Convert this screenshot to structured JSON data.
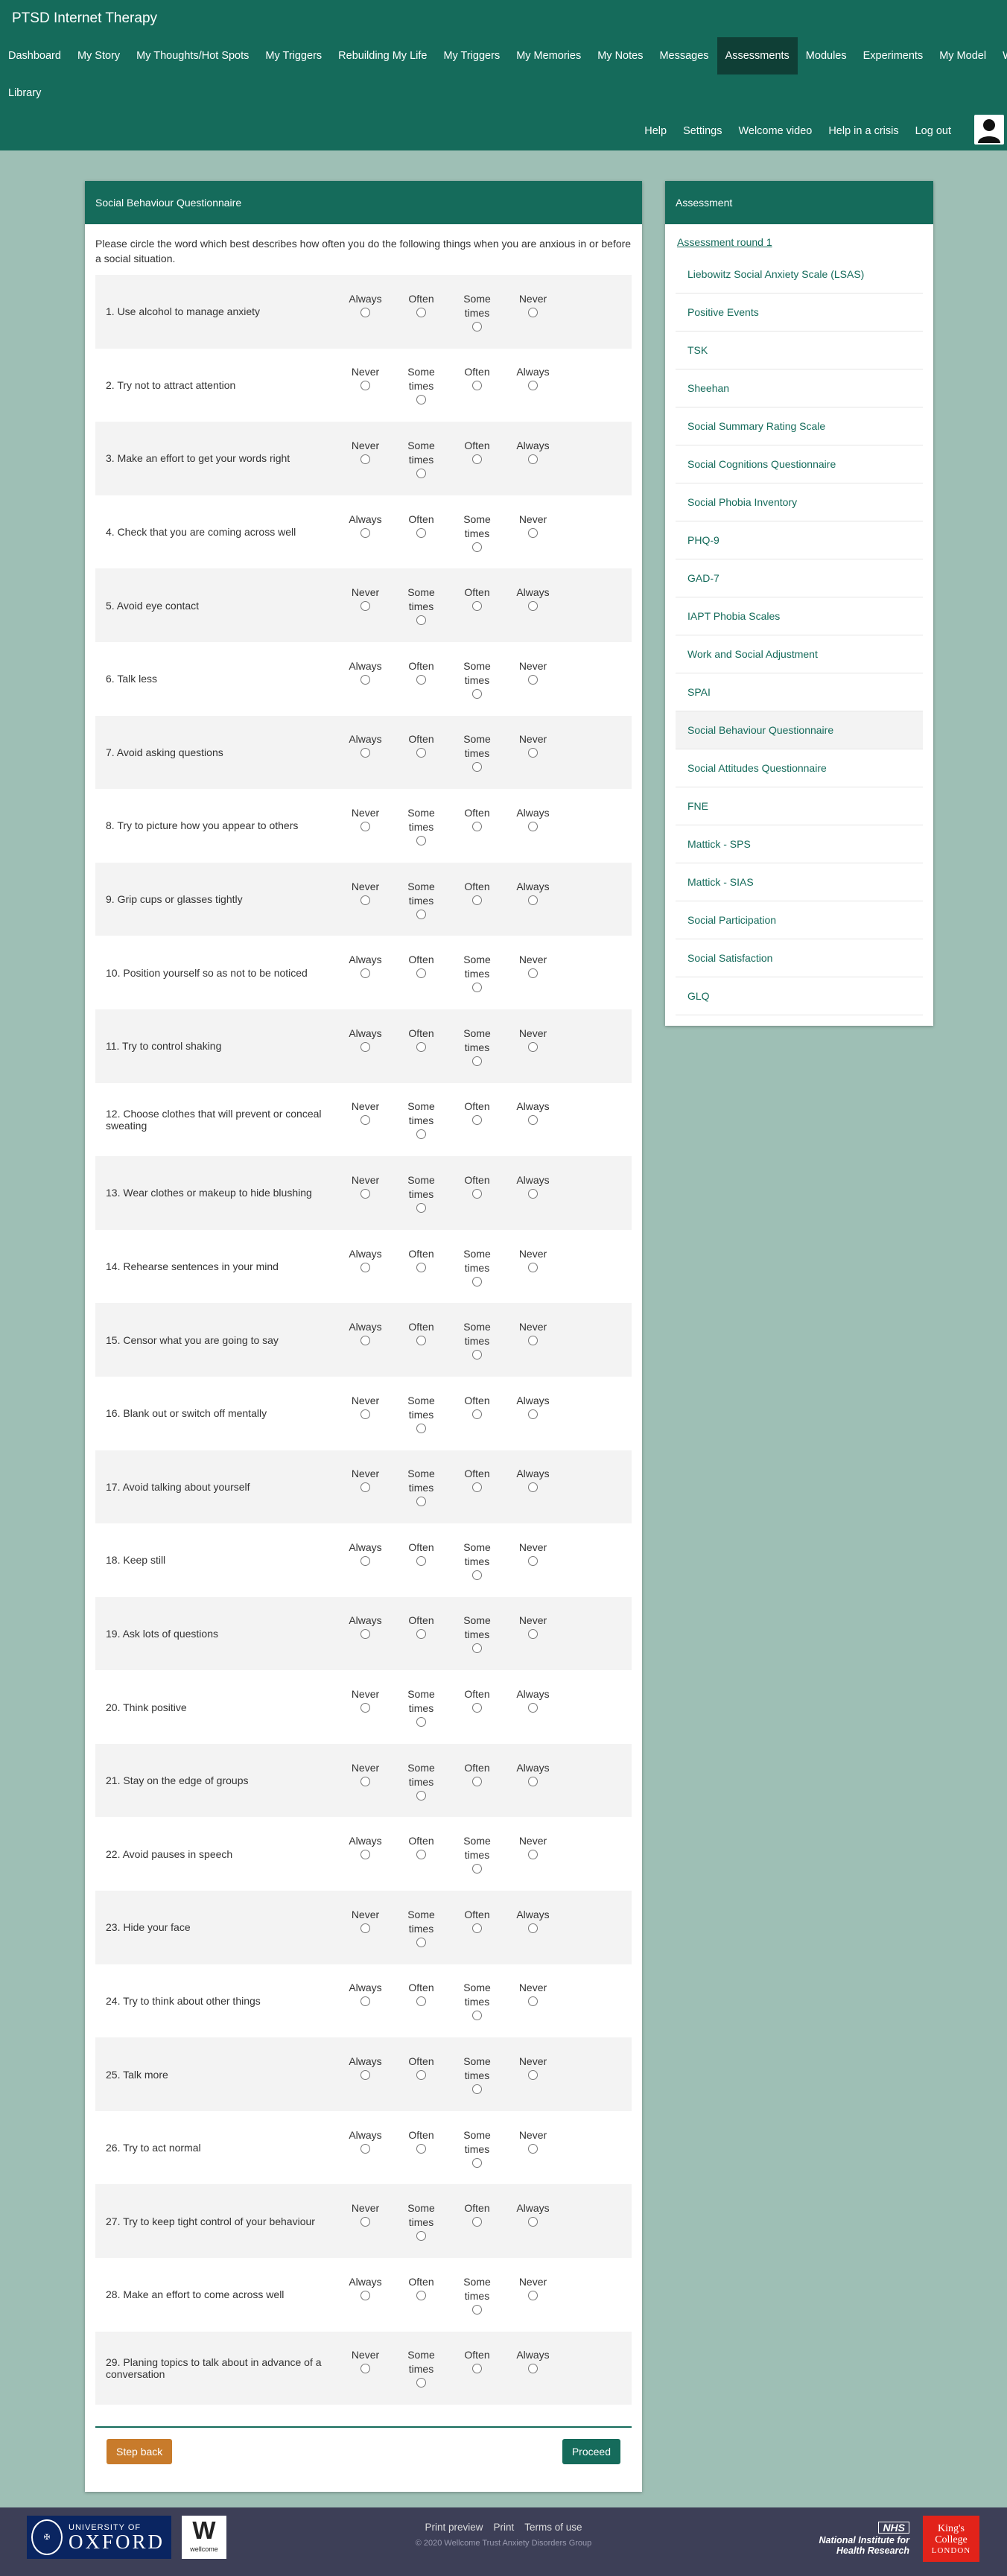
{
  "app": {
    "title": "PTSD Internet Therapy"
  },
  "nav": {
    "items": [
      "Dashboard",
      "My Story",
      "My Thoughts/Hot Spots",
      "My Triggers",
      "Rebuilding My Life",
      "My Triggers",
      "My Memories",
      "My Notes",
      "Messages",
      "Assessments",
      "Modules",
      "Experiments",
      "My Model",
      "Webcam"
    ],
    "items2": [
      "Library"
    ],
    "active": "Assessments"
  },
  "util": {
    "items": [
      "Help",
      "Settings",
      "Welcome video",
      "Help in a crisis",
      "Log out"
    ]
  },
  "questionnaire": {
    "title": "Social Behaviour Questionnaire",
    "instructions": "Please circle the word which best describes how often you do the following things when you are anxious in or before a social situation.",
    "questions": [
      {
        "label": "1. Use alcohol to manage anxiety",
        "options": [
          "Always",
          "Often",
          "Some times",
          "Never"
        ]
      },
      {
        "label": "2. Try not to attract attention",
        "options": [
          "Never",
          "Some times",
          "Often",
          "Always"
        ]
      },
      {
        "label": "3. Make an effort to get your words right",
        "options": [
          "Never",
          "Some times",
          "Often",
          "Always"
        ]
      },
      {
        "label": "4. Check that you are coming across well",
        "options": [
          "Always",
          "Often",
          "Some times",
          "Never"
        ]
      },
      {
        "label": "5. Avoid eye contact",
        "options": [
          "Never",
          "Some times",
          "Often",
          "Always"
        ]
      },
      {
        "label": "6. Talk less",
        "options": [
          "Always",
          "Often",
          "Some times",
          "Never"
        ]
      },
      {
        "label": "7. Avoid asking questions",
        "options": [
          "Always",
          "Often",
          "Some times",
          "Never"
        ]
      },
      {
        "label": "8. Try to picture how you appear to others",
        "options": [
          "Never",
          "Some times",
          "Often",
          "Always"
        ]
      },
      {
        "label": "9. Grip cups or glasses tightly",
        "options": [
          "Never",
          "Some times",
          "Often",
          "Always"
        ]
      },
      {
        "label": "10. Position yourself so as not to be noticed",
        "options": [
          "Always",
          "Often",
          "Some times",
          "Never"
        ]
      },
      {
        "label": "11. Try to control shaking",
        "options": [
          "Always",
          "Often",
          "Some times",
          "Never"
        ]
      },
      {
        "label": "12. Choose clothes that will prevent or conceal sweating",
        "options": [
          "Never",
          "Some times",
          "Often",
          "Always"
        ]
      },
      {
        "label": "13. Wear clothes or makeup to hide blushing",
        "options": [
          "Never",
          "Some times",
          "Often",
          "Always"
        ]
      },
      {
        "label": "14. Rehearse sentences in your mind",
        "options": [
          "Always",
          "Often",
          "Some times",
          "Never"
        ]
      },
      {
        "label": "15. Censor what you are going to say",
        "options": [
          "Always",
          "Often",
          "Some times",
          "Never"
        ]
      },
      {
        "label": "16. Blank out or switch off mentally",
        "options": [
          "Never",
          "Some times",
          "Often",
          "Always"
        ]
      },
      {
        "label": "17. Avoid talking about yourself",
        "options": [
          "Never",
          "Some times",
          "Often",
          "Always"
        ]
      },
      {
        "label": "18. Keep still",
        "options": [
          "Always",
          "Often",
          "Some times",
          "Never"
        ]
      },
      {
        "label": "19. Ask lots of questions",
        "options": [
          "Always",
          "Often",
          "Some times",
          "Never"
        ]
      },
      {
        "label": "20. Think positive",
        "options": [
          "Never",
          "Some times",
          "Often",
          "Always"
        ]
      },
      {
        "label": "21. Stay on the edge of groups",
        "options": [
          "Never",
          "Some times",
          "Often",
          "Always"
        ]
      },
      {
        "label": "22. Avoid pauses in speech",
        "options": [
          "Always",
          "Often",
          "Some times",
          "Never"
        ]
      },
      {
        "label": "23. Hide your face",
        "options": [
          "Never",
          "Some times",
          "Often",
          "Always"
        ]
      },
      {
        "label": "24. Try to think about other things",
        "options": [
          "Always",
          "Often",
          "Some times",
          "Never"
        ]
      },
      {
        "label": "25. Talk more",
        "options": [
          "Always",
          "Often",
          "Some times",
          "Never"
        ]
      },
      {
        "label": "26. Try to act normal",
        "options": [
          "Always",
          "Often",
          "Some times",
          "Never"
        ]
      },
      {
        "label": "27. Try to keep tight control of your behaviour",
        "options": [
          "Never",
          "Some times",
          "Often",
          "Always"
        ]
      },
      {
        "label": "28. Make an effort to come across well",
        "options": [
          "Always",
          "Often",
          "Some times",
          "Never"
        ]
      },
      {
        "label": "29. Planing topics to talk about in advance of a conversation",
        "options": [
          "Never",
          "Some times",
          "Often",
          "Always"
        ]
      }
    ],
    "back_label": "Step back",
    "proceed_label": "Proceed"
  },
  "assessment": {
    "title": "Assessment",
    "round_label": "Assessment round 1",
    "items": [
      "Liebowitz Social Anxiety Scale (LSAS)",
      "Positive Events",
      "TSK",
      "Sheehan",
      "Social Summary Rating Scale",
      "Social Cognitions Questionnaire",
      "Social Phobia Inventory",
      "PHQ-9",
      "GAD-7",
      "IAPT Phobia Scales",
      "Work and Social Adjustment",
      "SPAI",
      "Social Behaviour Questionnaire",
      "Social Attitudes Questionnaire",
      "FNE",
      "Mattick - SPS",
      "Mattick - SIAS",
      "Social Participation",
      "Social Satisfaction",
      "GLQ"
    ],
    "active_index": 12
  },
  "footer": {
    "links": [
      "Print preview",
      "Print",
      "Terms of use"
    ],
    "copyright": "© 2020 Wellcome Trust Anxiety Disorders Group",
    "oxford_top": "UNIVERSITY OF",
    "oxford_main": "OXFORD",
    "wellcome_letter": "W",
    "wellcome_name": "wellcome",
    "nhs": "NHS",
    "nihr_line1": "National Institute for",
    "nihr_line2": "Health Research",
    "kcl_line1": "King's",
    "kcl_line2": "College",
    "kcl_line3": "LONDON"
  },
  "colors": {
    "primary": "#156b5b",
    "active_nav": "#0f3f36",
    "background": "#9ebfb5",
    "back_button": "#c87b2b",
    "footer": "#3d3f57"
  }
}
